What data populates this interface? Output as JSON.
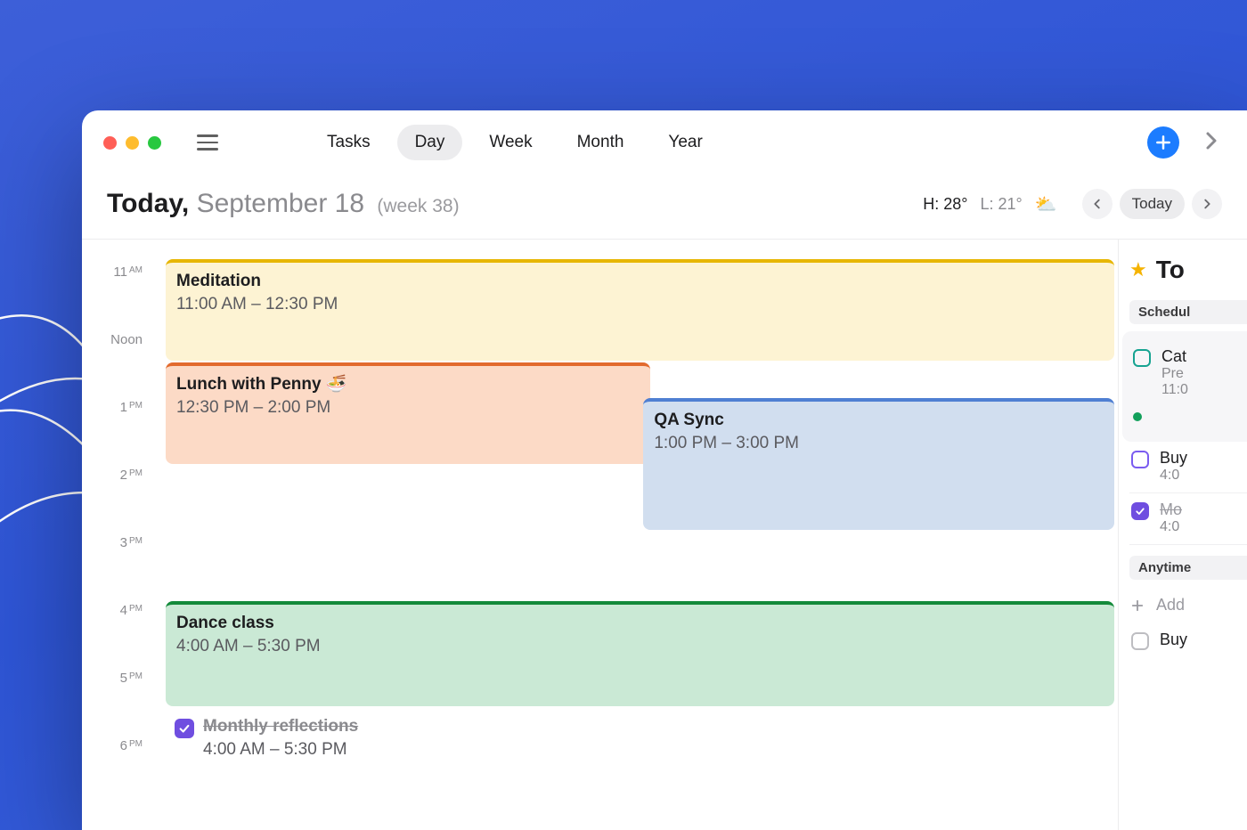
{
  "toolbar": {
    "views": [
      "Tasks",
      "Day",
      "Week",
      "Month",
      "Year"
    ],
    "active_view_index": 1
  },
  "header": {
    "today_prefix": "Today,",
    "date_label": "September 18",
    "week_label": "(week 38)",
    "weather_high": "H: 28°",
    "weather_low": "L: 21°",
    "today_button": "Today"
  },
  "hours": [
    {
      "label": "11",
      "ampm": "AM"
    },
    {
      "label": "Noon",
      "ampm": ""
    },
    {
      "label": "1",
      "ampm": "PM"
    },
    {
      "label": "2",
      "ampm": "PM"
    },
    {
      "label": "3",
      "ampm": "PM"
    },
    {
      "label": "4",
      "ampm": "PM"
    },
    {
      "label": "5",
      "ampm": "PM"
    },
    {
      "label": "6",
      "ampm": "PM"
    }
  ],
  "events": {
    "meditation": {
      "title": "Meditation",
      "time": "11:00 AM – 12:30 PM"
    },
    "lunch": {
      "title": "Lunch with Penny 🍜",
      "time": "12:30 PM – 2:00 PM"
    },
    "qa": {
      "title": "QA Sync",
      "time": "1:00 PM – 3:00 PM"
    },
    "dance": {
      "title": "Dance class",
      "time": "4:00 AM – 5:30 PM"
    },
    "reflect": {
      "title": "Monthly reflections",
      "time": "4:00 AM – 5:30 PM"
    }
  },
  "sidebar": {
    "title": "To",
    "section_scheduled": "Schedul",
    "section_anytime": "Anytime",
    "items": {
      "catchup": {
        "title": "Cat",
        "subtitle1": "Pre",
        "subtitle2": "11:0"
      },
      "buy": {
        "title": "Buy",
        "subtitle": "4:0"
      },
      "done": {
        "title": "Mo",
        "subtitle": "4:0"
      },
      "add": {
        "label": "Add"
      },
      "buy2": {
        "title": "Buy"
      }
    }
  }
}
